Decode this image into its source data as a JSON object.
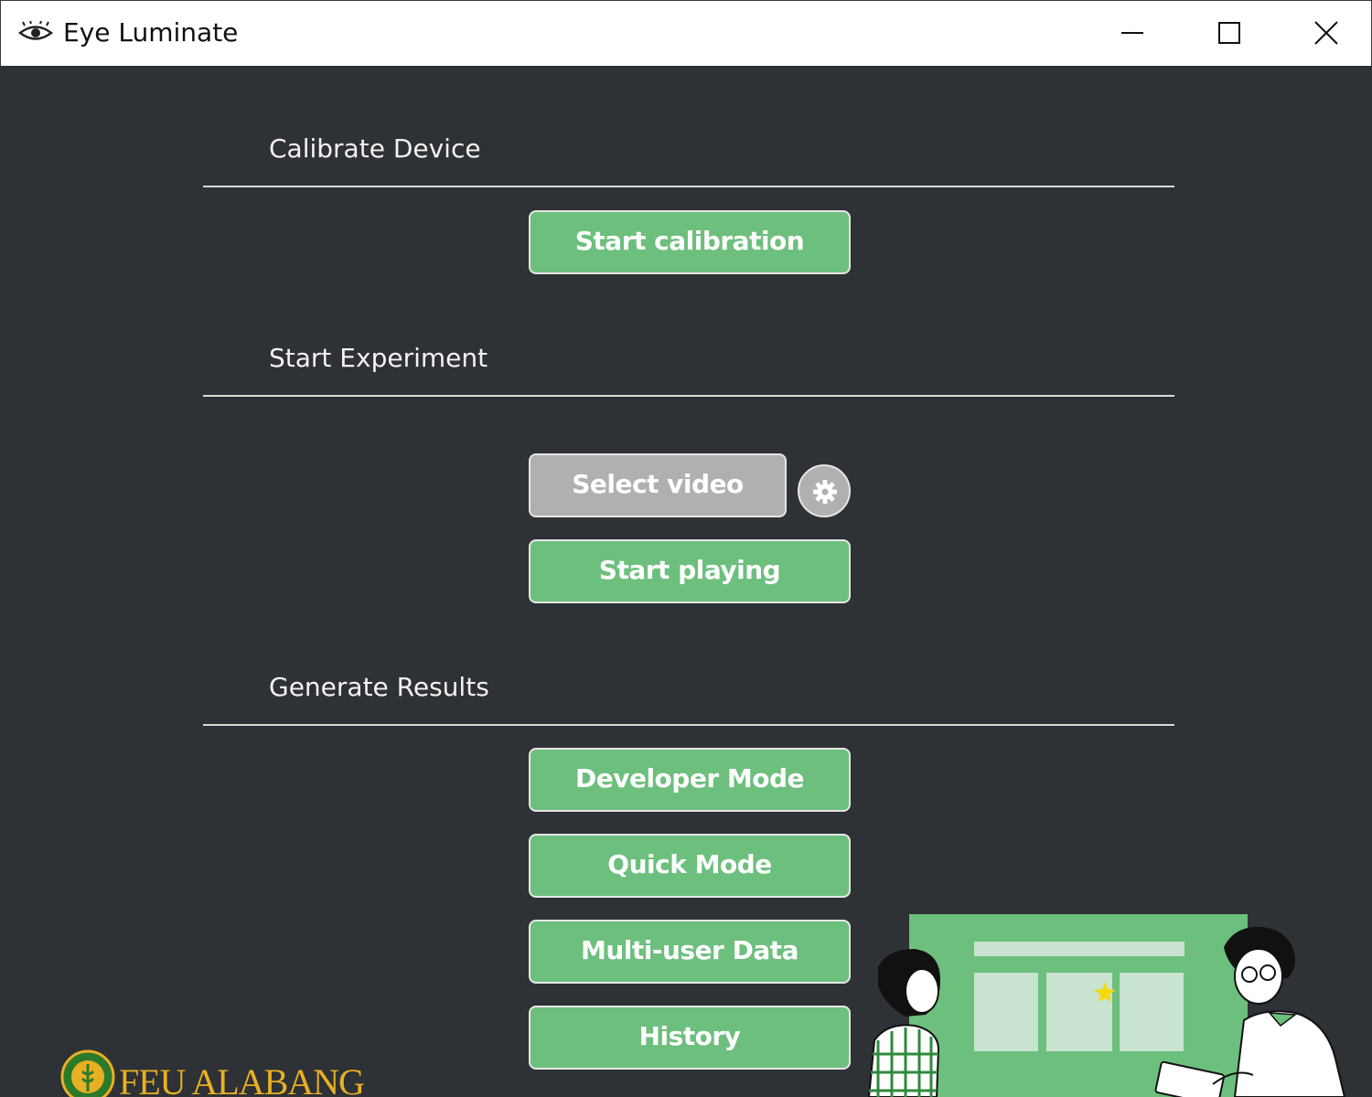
{
  "window": {
    "title": "Eye Luminate",
    "icon": "eye-icon",
    "controls": [
      "minimize-icon",
      "maximize-icon",
      "close-icon"
    ]
  },
  "sections": {
    "calibrate": {
      "title": "Calibrate Device",
      "start_calibration": "Start calibration"
    },
    "experiment": {
      "title": "Start Experiment",
      "select_video": "Select video",
      "settings_icon": "gear-icon",
      "start_playing": "Start playing"
    },
    "results": {
      "title": "Generate Results",
      "developer_mode": "Developer Mode",
      "quick_mode": "Quick Mode",
      "multi_user": "Multi-user Data",
      "history": "History"
    }
  },
  "footer": {
    "logo_text": "FEU ALABANG",
    "illustration": "people-presentation-illustration"
  },
  "colors": {
    "background": "#2e3135",
    "primary_button": "#6dbf7d",
    "secondary_button": "#b0b0b0",
    "logo": "#e8b023"
  }
}
